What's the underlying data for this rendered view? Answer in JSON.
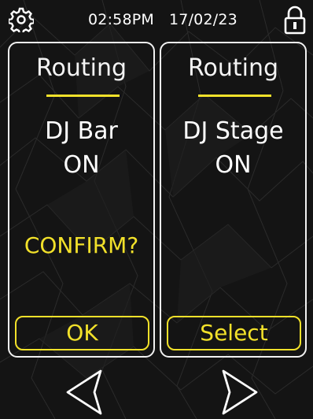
{
  "colors": {
    "accent": "#f2e12a",
    "text": "#f4f4f4",
    "background": "#151515"
  },
  "header": {
    "settings_icon": "gear-icon",
    "time": "02:58PM",
    "date": "17/02/23",
    "lock_icon": "lock-icon"
  },
  "panels": [
    {
      "title": "Routing",
      "device": "DJ Bar",
      "state": "ON",
      "prompt": "CONFIRM?",
      "button_label": "OK"
    },
    {
      "title": "Routing",
      "device": "DJ Stage",
      "state": "ON",
      "button_label": "Select"
    }
  ],
  "nav": {
    "prev_icon": "chevron-left-icon",
    "next_icon": "chevron-right-icon"
  }
}
